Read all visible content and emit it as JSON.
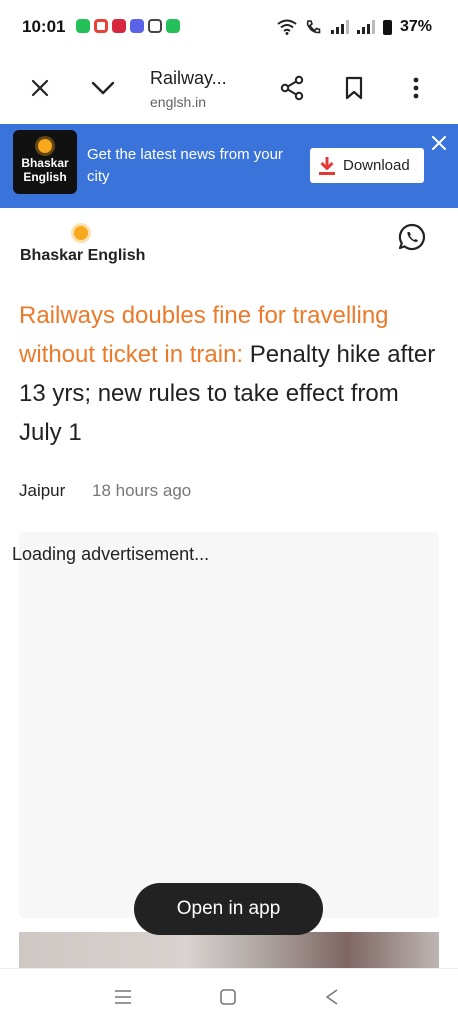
{
  "status_bar": {
    "time": "10:01",
    "battery": "37%",
    "notification_icons": [
      "whatsapp-icon",
      "google-icon",
      "shopping-bag-icon",
      "chrome-icon",
      "grid-dots-icon",
      "whatsapp-icon"
    ]
  },
  "browser": {
    "tab_title": "Railway...",
    "url": "englsh.in",
    "icons": [
      "close-icon",
      "chevron-down-icon",
      "share-icon",
      "bookmark-icon",
      "more-vert-icon"
    ]
  },
  "app_banner": {
    "logo_line1": "Bhaskar",
    "logo_line2": "English",
    "text": "Get the latest news from your city",
    "download_label": "Download",
    "accent": "#3a73d9"
  },
  "site": {
    "brand": "Bhaskar English"
  },
  "article": {
    "headline_accent": "Railways doubles fine for travelling without ticket in train:",
    "headline_rest": " Penalty hike after 13 yrs; new rules to take effect from July 1",
    "location": "Jaipur",
    "time_ago": "18 hours ago",
    "accent_color": "#ec7a2a"
  },
  "ad": {
    "loading_text": "Loading advertisement..."
  },
  "open_app": {
    "label": "Open in app"
  }
}
